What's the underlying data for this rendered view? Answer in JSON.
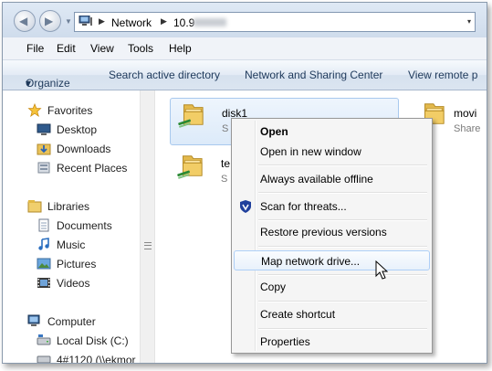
{
  "window": {
    "address": {
      "crumbs": [
        "Network",
        "10.9"
      ],
      "dropdown_glyph": "▾"
    }
  },
  "menubar": {
    "items": [
      "File",
      "Edit",
      "View",
      "Tools",
      "Help"
    ]
  },
  "commandbar": {
    "organize": "Organize",
    "organize_arrow": "▾",
    "search_ad": "Search active directory",
    "network_center": "Network and Sharing Center",
    "view_remote": "View remote p"
  },
  "navpane": {
    "favorites": {
      "header": "Favorites",
      "items": [
        "Desktop",
        "Downloads",
        "Recent Places"
      ]
    },
    "libraries": {
      "header": "Libraries",
      "items": [
        "Documents",
        "Music",
        "Pictures",
        "Videos"
      ]
    },
    "computer": {
      "header": "Computer",
      "items": [
        "Local Disk (C:)",
        "4#1120 (\\\\ekmor"
      ]
    }
  },
  "content": {
    "tiles": [
      {
        "name": "disk1",
        "sub": "S"
      },
      {
        "name": "te",
        "sub": "S"
      },
      {
        "name": "movi",
        "sub": "Share"
      }
    ]
  },
  "context_menu": {
    "items": {
      "open": "Open",
      "open_new_window": "Open in new window",
      "always_offline": "Always available offline",
      "scan": "Scan for threats...",
      "restore": "Restore previous versions",
      "map_drive": "Map network drive...",
      "copy": "Copy",
      "create_shortcut": "Create shortcut",
      "properties": "Properties"
    },
    "hovered_item": "Map network drive..."
  },
  "colors": {
    "frame_bg": "#d9e4f1",
    "command_text": "#1e395b",
    "menu_hover_border": "#aecff7",
    "selection_border": "#a8c9ee"
  }
}
